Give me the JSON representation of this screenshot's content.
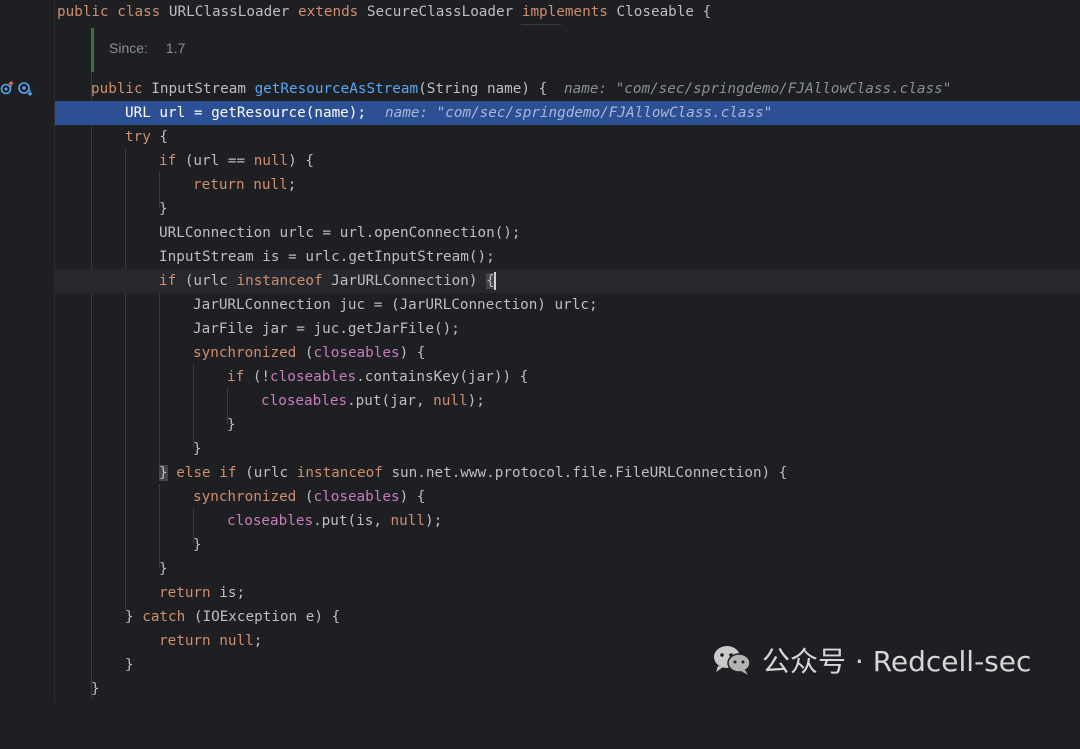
{
  "editor": {
    "theme_colors": {
      "background": "#1e1f22",
      "keyword": "#cf8e6d",
      "method": "#56a8f5",
      "field": "#c77dbb",
      "execution_line": "#2d4f93"
    },
    "doc_popup": {
      "label": "Since:",
      "value": "1.7"
    },
    "gutter_icons": [
      "override-method-icon",
      "debug-breakpoint-icon"
    ],
    "lines": {
      "l0_a": "public class ",
      "l0_b": "URLClassLoader ",
      "l0_c": "extends ",
      "l0_d": "SecureClassLoader ",
      "l0_e": "implements ",
      "l0_f": "Closeable {",
      "l1_a": "public ",
      "l1_b": "InputStream ",
      "l1_c": "getResourceAsStream",
      "l1_d": "(String name) {",
      "l1_hint": "name: \"com/sec/springdemo/FJAllowClass.class\"",
      "l2_a": "URL url = getResource(name);",
      "l2_hint": "name: \"com/sec/springdemo/FJAllowClass.class\"",
      "l3_a": "try",
      "l3_b": " {",
      "l4_a": "if",
      "l4_b": " (url == ",
      "l4_c": "null",
      "l4_d": ") {",
      "l5_a": "return ",
      "l5_b": "null",
      "l5_c": ";",
      "l6_a": "}",
      "l7_a": "URLConnection urlc = url.openConnection();",
      "l8_a": "InputStream is = urlc.getInputStream();",
      "l9_a": "if",
      "l9_b": " (urlc ",
      "l9_c": "instanceof ",
      "l9_d": "JarURLConnection) ",
      "l9_e": "{",
      "l10_a": "JarURLConnection juc = (JarURLConnection) urlc;",
      "l11_a": "JarFile jar = juc.getJarFile();",
      "l12_a": "synchronized ",
      "l12_b": "(",
      "l12_c": "closeables",
      "l12_d": ") {",
      "l13_a": "if",
      "l13_b": " (!",
      "l13_c": "closeables",
      "l13_d": ".containsKey(jar)) {",
      "l14_a": "closeables",
      "l14_b": ".put(jar, ",
      "l14_c": "null",
      "l14_d": ");",
      "l15_a": "}",
      "l16_a": "}",
      "l17_a": "}",
      "l17_b": " else if",
      "l17_c": " (urlc ",
      "l17_d": "instanceof ",
      "l17_e": "sun.net.www.protocol.file.FileURLConnection) {",
      "l18_a": "synchronized ",
      "l18_b": "(",
      "l18_c": "closeables",
      "l18_d": ") {",
      "l19_a": "closeables",
      "l19_b": ".put(is, ",
      "l19_c": "null",
      "l19_d": ");",
      "l20_a": "}",
      "l21_a": "}",
      "l22_a": "return ",
      "l22_b": "is;",
      "l23_a": "} ",
      "l23_b": "catch ",
      "l23_c": "(IOException e) {",
      "l24_a": "return ",
      "l24_b": "null",
      "l24_c": ";",
      "l25_a": "}",
      "l26_a": "}"
    }
  },
  "watermark": {
    "text": "公众号 · Redcell-sec",
    "logo_icon": "wechat-logo-icon"
  }
}
